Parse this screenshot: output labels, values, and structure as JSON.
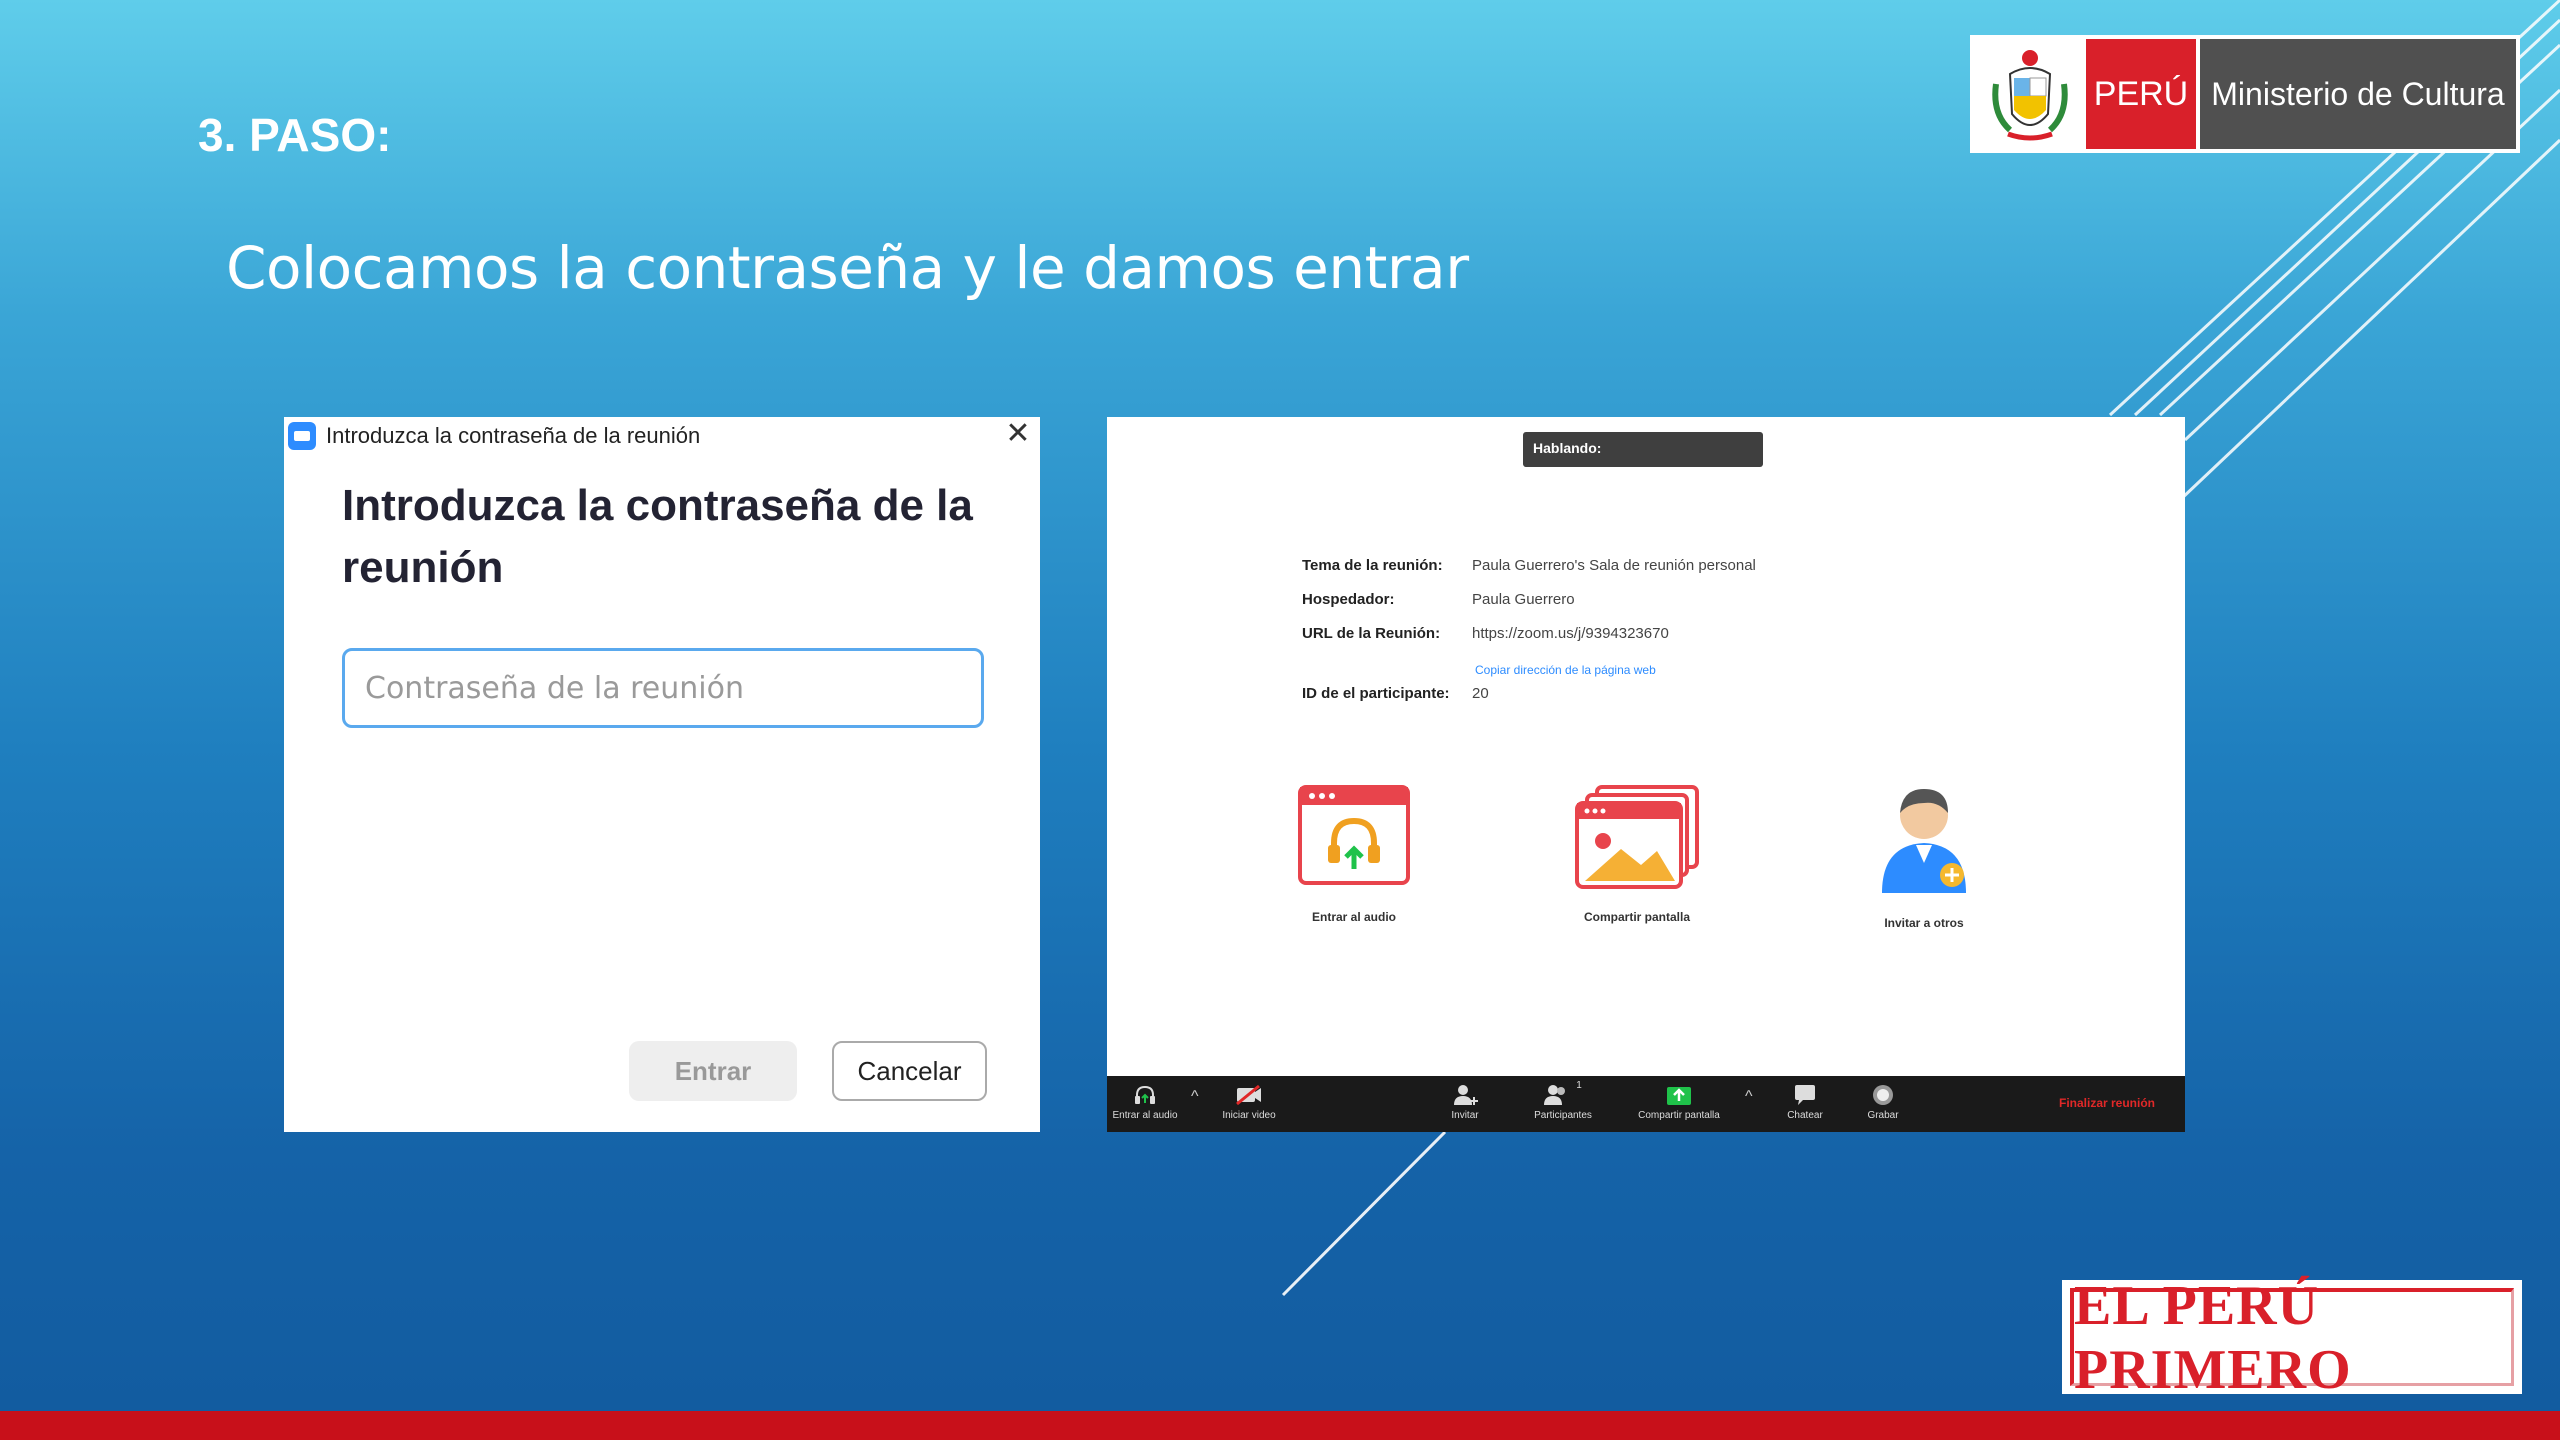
{
  "slide": {
    "step": "3. PASO:",
    "subtitle": "Colocamos la contraseña y le damos entrar"
  },
  "ministry_logo": {
    "country": "PERÚ",
    "ministry": "Ministerio de Cultura"
  },
  "brand_logo": {
    "text": "EL PERÚ PRIMERO"
  },
  "password_dialog": {
    "window_title": "Introduzca la contraseña de la reunión",
    "close_icon": "close-icon",
    "heading": "Introduzca la contraseña de la reunión",
    "input_placeholder": "Contraseña de la reunión",
    "input_value": "",
    "enter_label": "Entrar",
    "cancel_label": "Cancelar"
  },
  "zoom_meeting": {
    "speaking_label": "Hablando:",
    "info": [
      {
        "label": "Tema de la reunión:",
        "value": "Paula Guerrero's Sala de reunión personal"
      },
      {
        "label": "Hospedador:",
        "value": "Paula Guerrero"
      },
      {
        "label": "URL de la Reunión:",
        "value": "https://zoom.us/j/9394323670"
      },
      {
        "label": "ID de el participante:",
        "value": "20"
      }
    ],
    "copy_link": "Copiar dirección de la página web",
    "actions": [
      {
        "label": "Entrar al audio",
        "icon": "join-audio-icon"
      },
      {
        "label": "Compartir pantalla",
        "icon": "share-screen-icon"
      },
      {
        "label": "Invitar a otros",
        "icon": "invite-others-icon"
      }
    ],
    "toolbar": {
      "audio": "Entrar al audio",
      "video": "Iniciar video",
      "invite": "Invitar",
      "participants": "Participantes",
      "participants_count": "1",
      "share": "Compartir pantalla",
      "chat": "Chatear",
      "record": "Grabar",
      "end": "Finalizar reunión"
    }
  },
  "colors": {
    "accent_red": "#d9202a",
    "zoom_blue": "#2d8cff",
    "share_green": "#1fc24a"
  }
}
